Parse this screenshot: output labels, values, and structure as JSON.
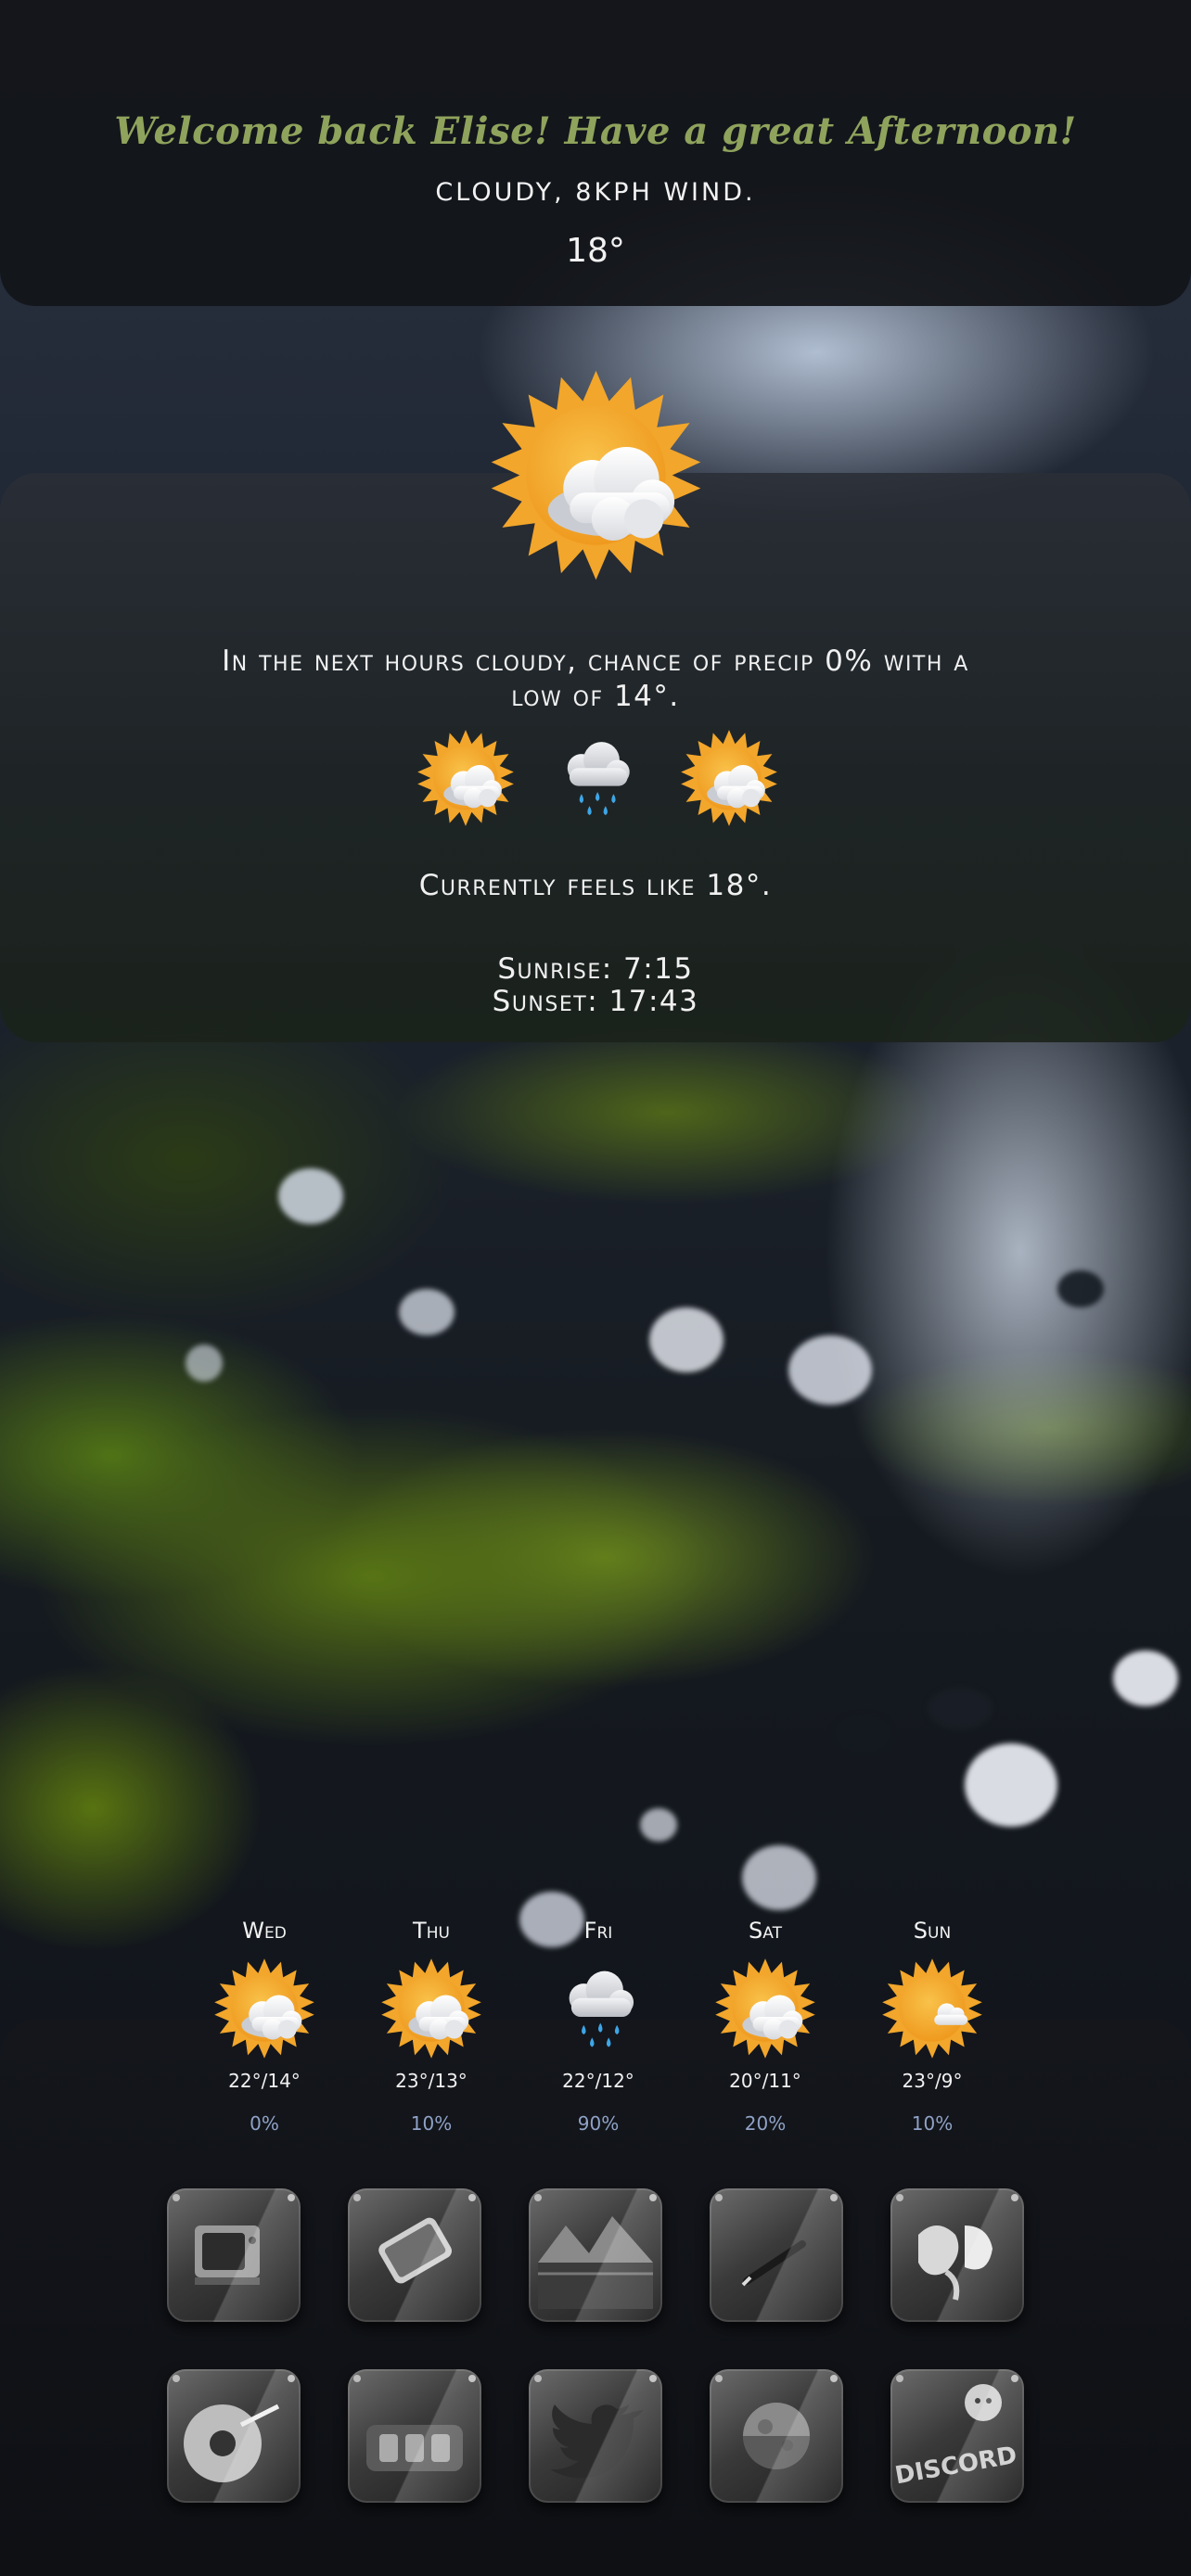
{
  "header": {
    "greeting": "Welcome back Elise! Have a great Afternoon!",
    "conditions": "CLOUDY, 8KPH WIND.",
    "temperature": "18°"
  },
  "current": {
    "icon": "sun-behind-cloud-icon",
    "forecast_line1": "In the next hours cloudy, chance of precip 0% with a",
    "forecast_line2": "low of 14°.",
    "hourly_icons": [
      "sun-behind-cloud-icon",
      "rain-cloud-icon",
      "sun-behind-cloud-icon"
    ],
    "feels_like": "Currently feels like 18°.",
    "sunrise": "Sunrise: 7:15",
    "sunset": "Sunset: 17:43"
  },
  "daily": [
    {
      "day": "Wed",
      "icon": "sun-behind-cloud-icon",
      "temps": "22°/14°",
      "precip": "0%"
    },
    {
      "day": "Thu",
      "icon": "sun-behind-cloud-icon",
      "temps": "23°/13°",
      "precip": "10%"
    },
    {
      "day": "Fri",
      "icon": "rain-cloud-icon",
      "temps": "22°/12°",
      "precip": "90%"
    },
    {
      "day": "Sat",
      "icon": "sun-behind-cloud-icon",
      "temps": "20°/11°",
      "precip": "20%"
    },
    {
      "day": "Sun",
      "icon": "sun-small-cloud-icon",
      "temps": "23°/9°",
      "precip": "10%"
    }
  ],
  "apps": [
    {
      "name": "tv-app-icon"
    },
    {
      "name": "phone-app-icon"
    },
    {
      "name": "photos-app-icon"
    },
    {
      "name": "notes-app-icon"
    },
    {
      "name": "maps-app-icon"
    },
    {
      "name": "files-app-icon"
    },
    {
      "name": "camera-app-icon"
    },
    {
      "name": "twitter-app-icon"
    },
    {
      "name": "moon-app-icon"
    },
    {
      "name": "discord-app-icon",
      "label": "DISCORD"
    }
  ],
  "colors": {
    "greeting": "#8fa35c",
    "precip": "#8fa2c6",
    "sun": "#f2a62b"
  }
}
